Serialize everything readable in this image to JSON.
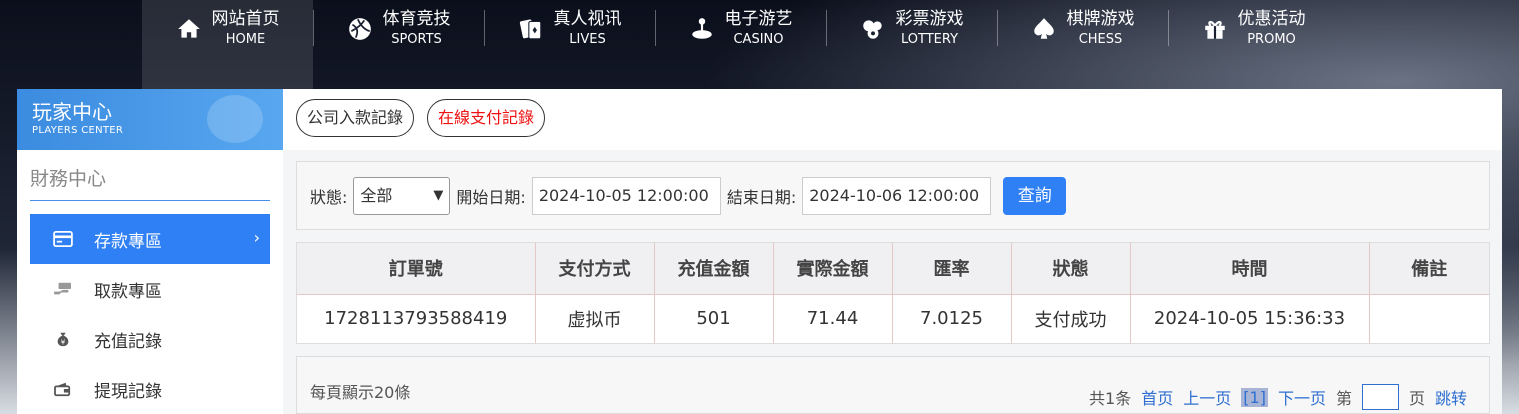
{
  "nav": {
    "items": [
      {
        "cn": "网站首页",
        "en": "HOME",
        "icon": "home-icon"
      },
      {
        "cn": "体育竞技",
        "en": "SPORTS",
        "icon": "ball-icon"
      },
      {
        "cn": "真人视讯",
        "en": "LIVES",
        "icon": "cards-icon"
      },
      {
        "cn": "电子游艺",
        "en": "CASINO",
        "icon": "joystick-icon"
      },
      {
        "cn": "彩票游戏",
        "en": "LOTTERY",
        "icon": "lottery-balls-icon"
      },
      {
        "cn": "棋牌游戏",
        "en": "CHESS",
        "icon": "spade-icon"
      },
      {
        "cn": "优惠活动",
        "en": "PROMO",
        "icon": "gift-icon"
      }
    ]
  },
  "sidebar": {
    "header_title": "玩家中心",
    "header_sub": "PLAYERS CENTER",
    "section": "財務中心",
    "items": [
      {
        "label": "存款專區",
        "icon": "card-icon"
      },
      {
        "label": "取款專區",
        "icon": "cash-hand-icon"
      },
      {
        "label": "充值記錄",
        "icon": "money-bag-icon"
      },
      {
        "label": "提現記錄",
        "icon": "wallet-icon"
      }
    ],
    "arrow": "›"
  },
  "tabs": [
    "公司入款記錄",
    "在線支付記錄"
  ],
  "filter": {
    "status_label": "狀態:",
    "status_value": "全部",
    "start_label": "開始日期:",
    "start_value": "2024-10-05 12:00:00",
    "end_label": "結束日期:",
    "end_value": "2024-10-06 12:00:00",
    "query_button": "查詢"
  },
  "table": {
    "headers": [
      "訂單號",
      "支付方式",
      "充值金額",
      "實際金額",
      "匯率",
      "狀態",
      "時間",
      "備註"
    ],
    "rows": [
      [
        "1728113793588419",
        "虚拟币",
        "501",
        "71.44",
        "7.0125",
        "支付成功",
        "2024-10-05 15:36:33",
        ""
      ]
    ]
  },
  "pager": {
    "per_page": "每頁顯示20條",
    "total": "共1条",
    "first": "首页",
    "prev": "上一页",
    "current": "[1]",
    "next": "下一页",
    "goto_prefix": "第",
    "goto_suffix": "页",
    "jump": "跳转"
  },
  "colors": {
    "accent": "#2f7ff5",
    "active_tab": "#e11111"
  }
}
